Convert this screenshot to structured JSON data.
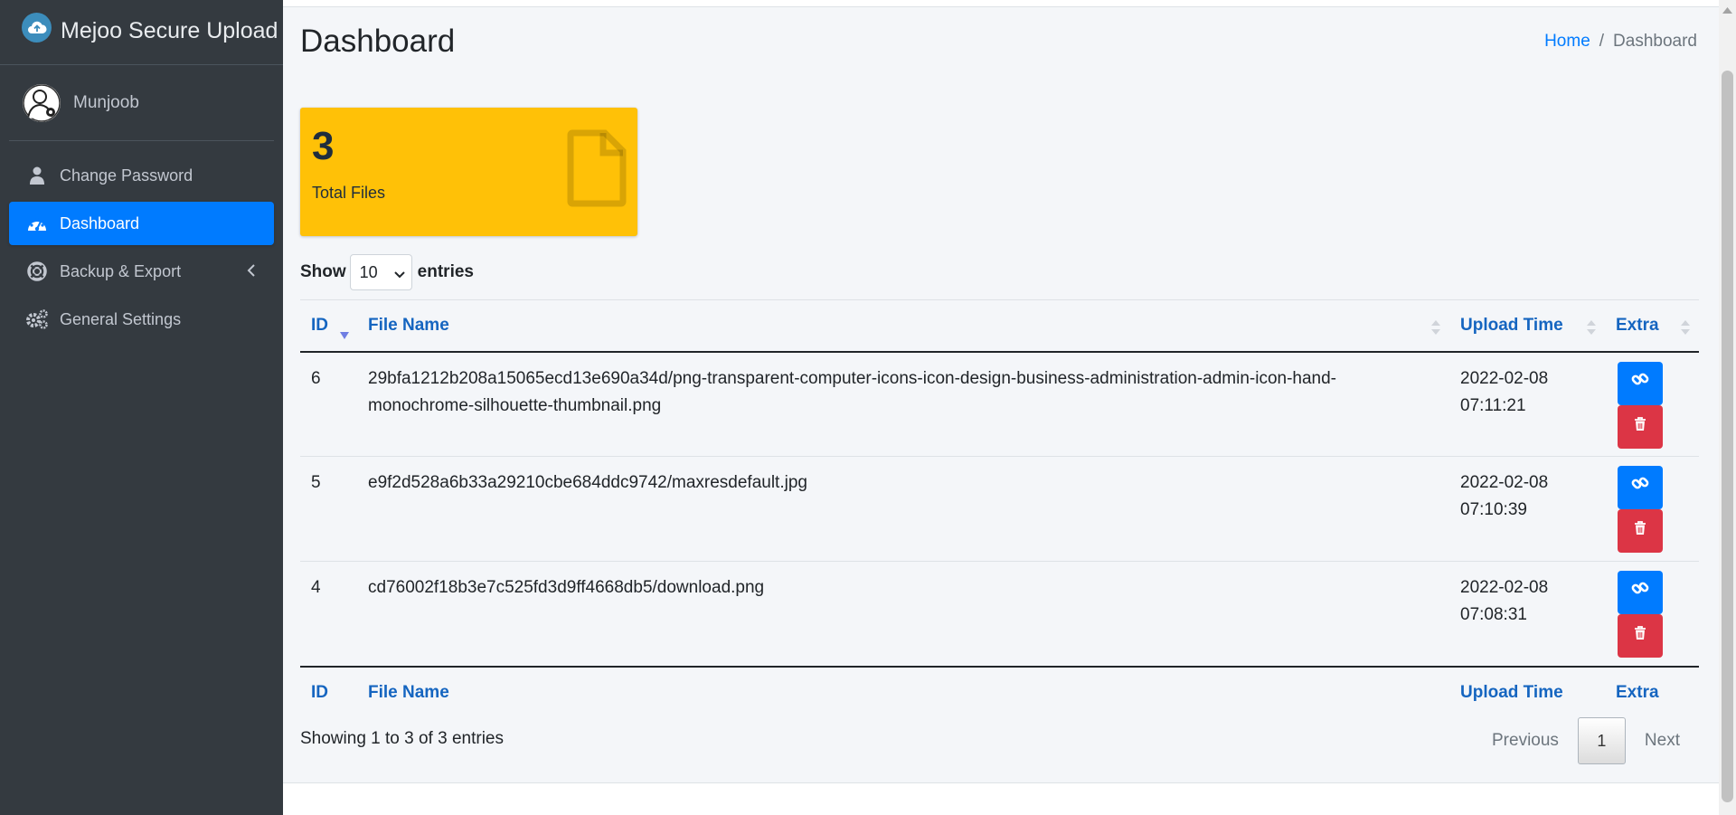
{
  "brand": {
    "name": "Mejoo Secure Upload"
  },
  "user": {
    "name": "Munjoob"
  },
  "sidebar": {
    "items": [
      {
        "label": "Change Password",
        "icon": "user-icon"
      },
      {
        "label": "Dashboard",
        "icon": "tachometer-icon",
        "active": true
      },
      {
        "label": "Backup & Export",
        "icon": "life-ring-icon",
        "has_submenu": true
      },
      {
        "label": "General Settings",
        "icon": "gears-icon"
      }
    ]
  },
  "header": {
    "title": "Dashboard",
    "breadcrumb": {
      "home": "Home",
      "separator": "/",
      "current": "Dashboard"
    }
  },
  "stat": {
    "value": "3",
    "label": "Total Files",
    "color": "#ffc107",
    "icon": "file-icon"
  },
  "table_controls": {
    "show_label": "Show",
    "entries_label": "entries",
    "page_length": "10"
  },
  "table": {
    "columns": [
      "ID",
      "File Name",
      "Upload Time",
      "Extra"
    ],
    "sorted_column": "ID",
    "rows": [
      {
        "id": "6",
        "file_name": "29bfa1212b208a15065ecd13e690a34d/png-transparent-computer-icons-icon-design-business-administration-admin-icon-hand-monochrome-silhouette-thumbnail.png",
        "upload_date": "2022-02-08",
        "upload_time": "07:11:21"
      },
      {
        "id": "5",
        "file_name": "e9f2d528a6b33a29210cbe684ddc9742/maxresdefault.jpg",
        "upload_date": "2022-02-08",
        "upload_time": "07:10:39"
      },
      {
        "id": "4",
        "file_name": "cd76002f18b3e7c525fd3d9ff4668db5/download.png",
        "upload_date": "2022-02-08",
        "upload_time": "07:08:31"
      }
    ]
  },
  "footer": {
    "info": "Showing 1 to 3 of 3 entries",
    "previous": "Previous",
    "current_page": "1",
    "next": "Next"
  },
  "colors": {
    "primary": "#007bff",
    "danger": "#dc3545",
    "sidebar": "#343a40",
    "warning": "#ffc107"
  }
}
